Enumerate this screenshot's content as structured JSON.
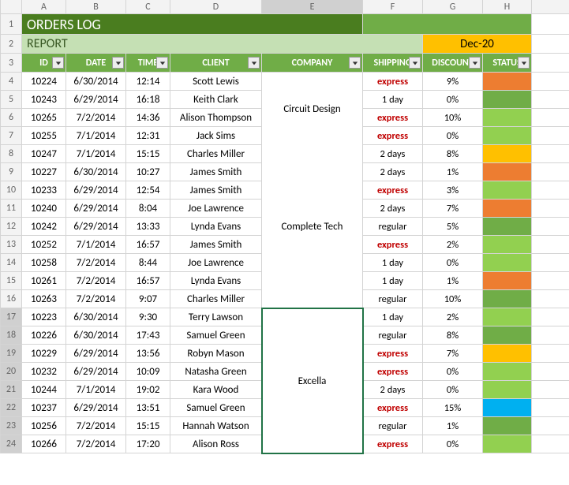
{
  "columns": [
    "A",
    "B",
    "C",
    "D",
    "E",
    "F",
    "G",
    "H"
  ],
  "row_numbers": [
    "1",
    "2",
    "3",
    "4",
    "5",
    "6",
    "7",
    "8",
    "9",
    "10",
    "11",
    "12",
    "13",
    "14",
    "15",
    "16",
    "17",
    "18",
    "19",
    "20",
    "21",
    "22",
    "23",
    "24"
  ],
  "title": "ORDERS LOG",
  "report_label": "REPORT",
  "report_date": "Dec-20",
  "headers": {
    "id": "ID",
    "date": "DATE",
    "time": "TIME",
    "client": "CLIENT",
    "company": "COMPANY",
    "shipping": "SHIPPING",
    "discount": "DISCOUNT",
    "status": "STATUS"
  },
  "companies": [
    "Circuit Design",
    "Complete Tech",
    "Excella"
  ],
  "rows": [
    {
      "id": "10224",
      "date": "6/30/2014",
      "time": "12:14",
      "client": "Scott Lewis",
      "shipping": "express",
      "discount": "9%",
      "status": "orange"
    },
    {
      "id": "10243",
      "date": "6/29/2014",
      "time": "16:18",
      "client": "Keith Clark",
      "shipping": "1 day",
      "discount": "0%",
      "status": "green"
    },
    {
      "id": "10265",
      "date": "7/2/2014",
      "time": "14:36",
      "client": "Alison Thompson",
      "shipping": "express",
      "discount": "10%",
      "status": "lime"
    },
    {
      "id": "10255",
      "date": "7/1/2014",
      "time": "12:31",
      "client": "Jack Sims",
      "shipping": "express",
      "discount": "0%",
      "status": "lime"
    },
    {
      "id": "10247",
      "date": "7/1/2014",
      "time": "15:15",
      "client": "Charles Miller",
      "shipping": "2 days",
      "discount": "8%",
      "status": "yellow"
    },
    {
      "id": "10227",
      "date": "6/30/2014",
      "time": "10:27",
      "client": "James Smith",
      "shipping": "2 days",
      "discount": "1%",
      "status": "orange"
    },
    {
      "id": "10233",
      "date": "6/29/2014",
      "time": "12:54",
      "client": "James Smith",
      "shipping": "express",
      "discount": "3%",
      "status": "lime"
    },
    {
      "id": "10240",
      "date": "6/29/2014",
      "time": "8:04",
      "client": "Joe Lawrence",
      "shipping": "2 days",
      "discount": "7%",
      "status": "orange"
    },
    {
      "id": "10242",
      "date": "6/29/2014",
      "time": "13:33",
      "client": "Lynda Evans",
      "shipping": "regular",
      "discount": "5%",
      "status": "green"
    },
    {
      "id": "10252",
      "date": "7/1/2014",
      "time": "16:57",
      "client": "James Smith",
      "shipping": "express",
      "discount": "2%",
      "status": "lime"
    },
    {
      "id": "10258",
      "date": "7/2/2014",
      "time": "8:44",
      "client": "Joe Lawrence",
      "shipping": "1 day",
      "discount": "0%",
      "status": "lime"
    },
    {
      "id": "10261",
      "date": "7/2/2014",
      "time": "16:57",
      "client": "Lynda Evans",
      "shipping": "1 day",
      "discount": "1%",
      "status": "orange"
    },
    {
      "id": "10263",
      "date": "7/2/2014",
      "time": "9:07",
      "client": "Charles Miller",
      "shipping": "regular",
      "discount": "10%",
      "status": "green"
    },
    {
      "id": "10223",
      "date": "6/30/2014",
      "time": "9:30",
      "client": "Terry Lawson",
      "shipping": "1 day",
      "discount": "2%",
      "status": "lime"
    },
    {
      "id": "10226",
      "date": "6/30/2014",
      "time": "17:43",
      "client": "Samuel Green",
      "shipping": "regular",
      "discount": "8%",
      "status": "green"
    },
    {
      "id": "10229",
      "date": "6/29/2014",
      "time": "13:56",
      "client": "Robyn Mason",
      "shipping": "express",
      "discount": "7%",
      "status": "yellow"
    },
    {
      "id": "10232",
      "date": "6/29/2014",
      "time": "10:09",
      "client": "Natasha Green",
      "shipping": "express",
      "discount": "0%",
      "status": "lime"
    },
    {
      "id": "10244",
      "date": "7/1/2014",
      "time": "19:02",
      "client": "Kara Wood",
      "shipping": "2 days",
      "discount": "0%",
      "status": "lime"
    },
    {
      "id": "10237",
      "date": "6/29/2014",
      "time": "13:51",
      "client": "Samuel Green",
      "shipping": "express",
      "discount": "15%",
      "status": "blue"
    },
    {
      "id": "10256",
      "date": "7/2/2014",
      "time": "15:15",
      "client": "Hannah Watson",
      "shipping": "regular",
      "discount": "1%",
      "status": "green"
    },
    {
      "id": "10266",
      "date": "7/2/2014",
      "time": "17:20",
      "client": "Alison Ross",
      "shipping": "express",
      "discount": "0%",
      "status": "lime"
    }
  ]
}
